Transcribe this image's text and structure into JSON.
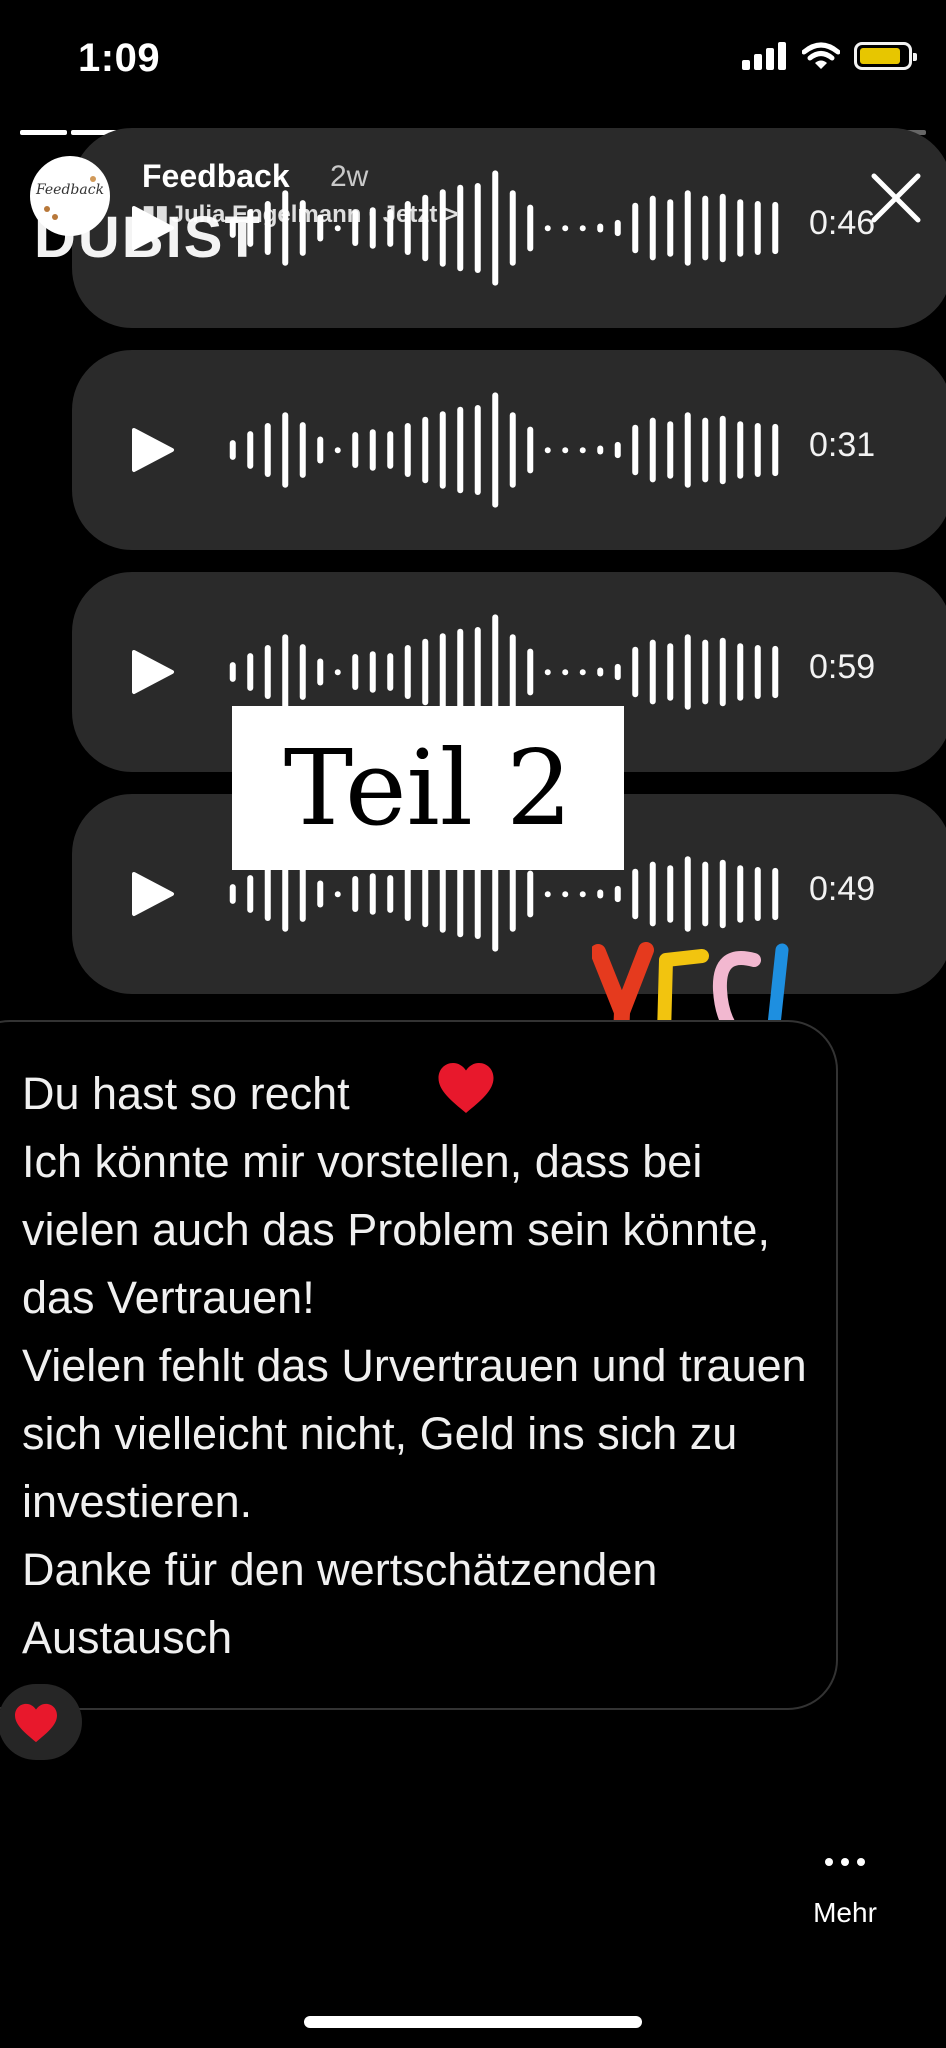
{
  "status_bar": {
    "time": "1:09"
  },
  "story": {
    "progress_segments": 18,
    "progress_done": 15,
    "header": {
      "avatar_text": "Feedback",
      "name": "Feedback",
      "age": "2w",
      "subtitle": "Julia Engelmann · Jetzt >"
    },
    "voice_messages": [
      {
        "duration": "0:46"
      },
      {
        "duration": "0:31"
      },
      {
        "duration": "0:59"
      },
      {
        "duration": "0:49"
      }
    ],
    "overlay_text": "DUBIST",
    "sticker_teil": "Teil 2",
    "sticker_yes": "YES!",
    "message_text": "Du hast so recht\nIch könnte mir vorstellen, dass bei vielen auch das Problem sein könnte, das Vertrauen!\nVielen fehlt das Urvertrauen und trauen sich vielleicht nicht, Geld ins sich zu investieren.\nDanke für den wertschätzenden Austausch",
    "reaction": "heart",
    "more_label": "Mehr"
  },
  "colors": {
    "background": "#000000",
    "bubble": "#2a2a2a",
    "battery": "#f4d100",
    "heart": "#e8182c",
    "yes_y": "#e53a1e",
    "yes_e": "#f2c40f",
    "yes_s": "#f2b8d0",
    "yes_bang": "#1e8fe0"
  }
}
